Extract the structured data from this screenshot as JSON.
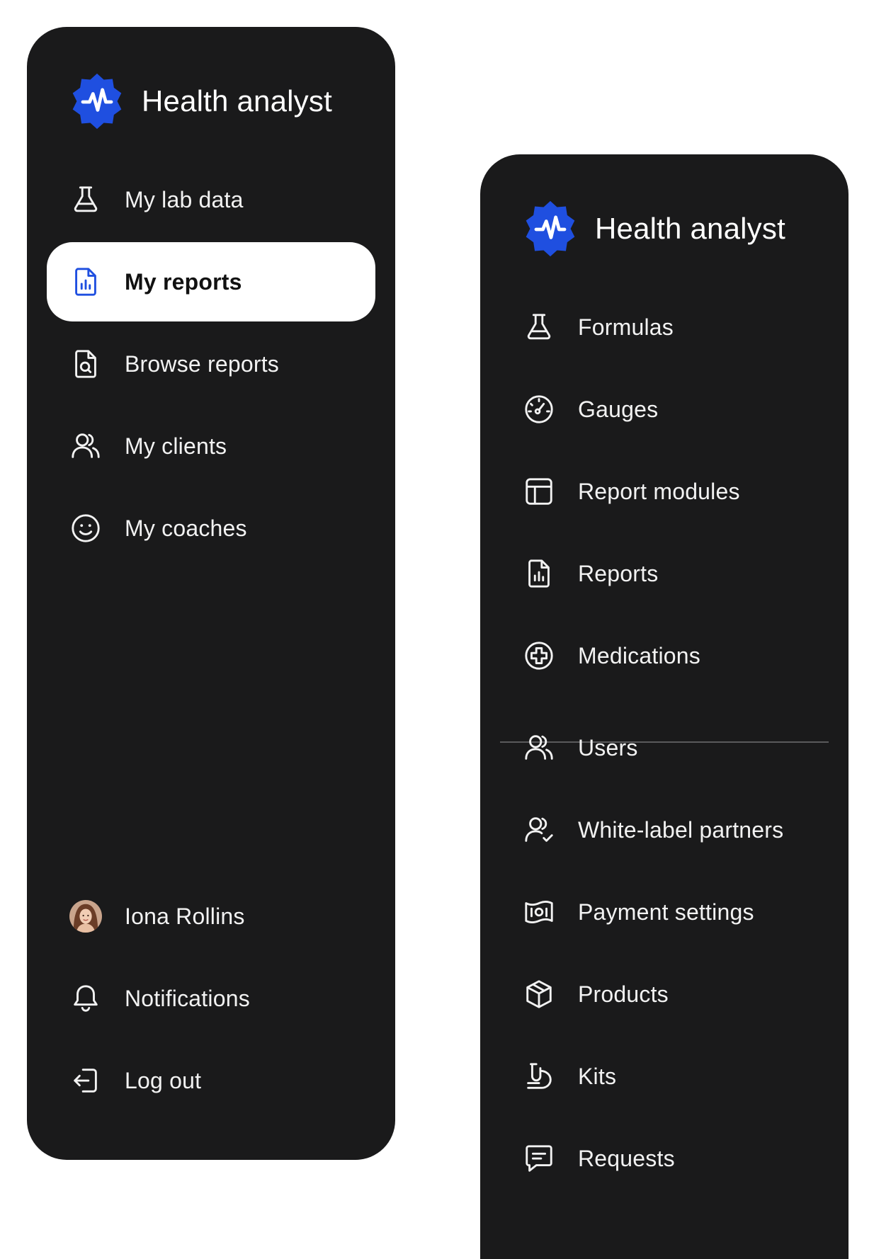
{
  "brand_color": "#1f4fe0",
  "left_panel": {
    "title": "Health analyst",
    "items": [
      {
        "label": "My lab data",
        "icon": "flask-icon"
      },
      {
        "label": "My reports",
        "icon": "report-chart-icon",
        "active": true
      },
      {
        "label": "Browse reports",
        "icon": "search-document-icon"
      },
      {
        "label": "My clients",
        "icon": "users-icon"
      },
      {
        "label": "My coaches",
        "icon": "smiley-icon"
      }
    ],
    "footer": [
      {
        "label": "Iona Rollins",
        "icon": "avatar"
      },
      {
        "label": "Notifications",
        "icon": "bell-icon"
      },
      {
        "label": "Log out",
        "icon": "logout-icon"
      }
    ]
  },
  "right_panel": {
    "title": "Health analyst",
    "items": [
      {
        "label": "Formulas",
        "icon": "flask-icon"
      },
      {
        "label": "Gauges",
        "icon": "gauge-icon"
      },
      {
        "label": "Report modules",
        "icon": "layout-icon"
      },
      {
        "label": "Reports",
        "icon": "report-chart-icon"
      },
      {
        "label": "Medications",
        "icon": "medical-cross-icon"
      },
      {
        "label": "Users",
        "icon": "users-icon"
      },
      {
        "label": "White-label partners",
        "icon": "user-check-icon"
      },
      {
        "label": "Payment settings",
        "icon": "banknote-icon"
      },
      {
        "label": "Products",
        "icon": "box-icon"
      },
      {
        "label": "Kits",
        "icon": "kit-icon"
      },
      {
        "label": "Requests",
        "icon": "message-icon"
      }
    ]
  }
}
